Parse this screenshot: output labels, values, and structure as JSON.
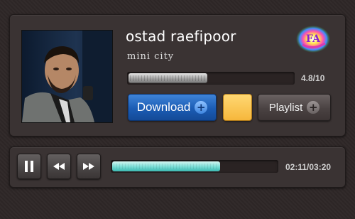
{
  "track": {
    "title": "ostad raefipoor",
    "subtitle": "mini city",
    "rating_text": "4.8/10",
    "rating_value": 4.8,
    "rating_max": 10,
    "logo_text": "FA"
  },
  "buttons": {
    "download_label": "Download",
    "playlist_label": "Playlist",
    "plus_glyph": "+",
    "color_swatch": "#f6b73c"
  },
  "player": {
    "pause_glyph": "❚❚",
    "rewind_glyph": "◀◀",
    "forward_glyph": "▶▶",
    "time_text": "02:11/03:20",
    "progress_fraction": 0.655
  },
  "icons": {
    "download": "plus-circle-icon",
    "playlist": "plus-circle-icon",
    "pause": "pause-icon",
    "rewind": "rewind-icon",
    "forward": "fast-forward-icon"
  },
  "colors": {
    "accent_blue": "#1b5cb4",
    "progress_teal": "#5fd4cc",
    "background": "#2e2727"
  }
}
